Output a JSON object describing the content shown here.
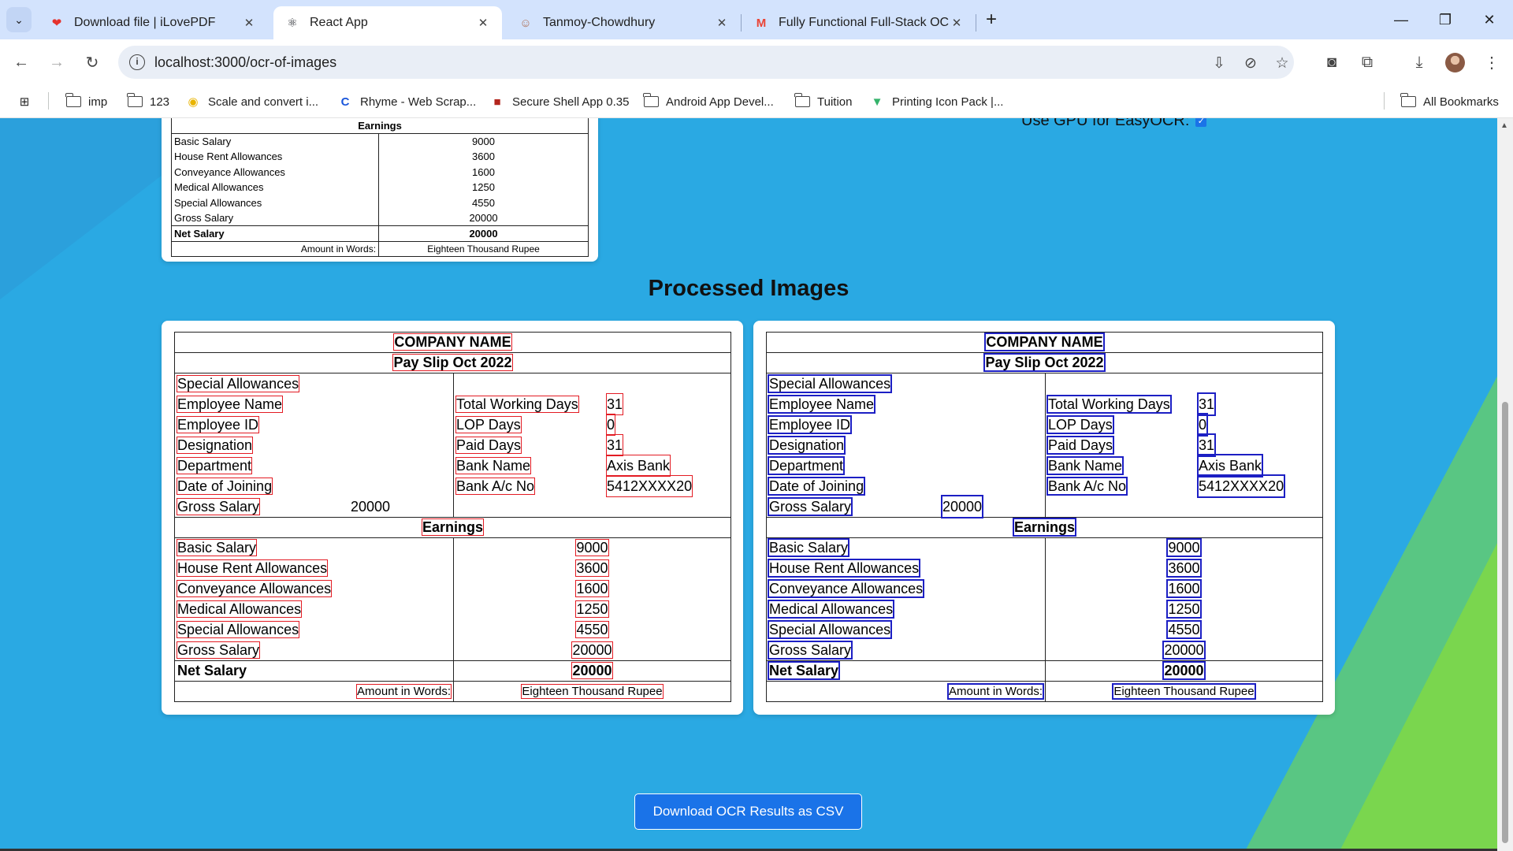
{
  "browser": {
    "tabs": [
      {
        "title": "Download file | iLovePDF",
        "icon": "heart-pdf-icon",
        "active": false
      },
      {
        "title": "React App",
        "icon": "react-icon",
        "active": true
      },
      {
        "title": "Tanmoy-Chowdhury",
        "icon": "person-icon",
        "active": false
      },
      {
        "title": "Fully Functional Full-Stack OCR",
        "icon": "gmail-icon",
        "active": false
      }
    ],
    "url": "localhost:3000/ocr-of-images",
    "bookmarks": [
      {
        "label": "imp",
        "icon": "folder-icon"
      },
      {
        "label": "123",
        "icon": "folder-icon"
      },
      {
        "label": "Scale and convert i...",
        "icon": "coin-icon"
      },
      {
        "label": "Rhyme - Web Scrap...",
        "icon": "rhyme-icon"
      },
      {
        "label": "Secure Shell App 0.35",
        "icon": "ssh-icon"
      },
      {
        "label": "Android App Devel...",
        "icon": "folder-icon"
      },
      {
        "label": "Tuition",
        "icon": "folder-icon"
      },
      {
        "label": "Printing Icon Pack |...",
        "icon": "v-icon"
      }
    ],
    "all_bookmarks": "All Bookmarks"
  },
  "page": {
    "gpu_label": "Use GPU for EasyOCR:",
    "gpu_checked": true,
    "processed_title": "Processed Images",
    "download_button": "Download OCR Results as CSV",
    "colors": {
      "background": "#2aa9e3",
      "button": "#1a73e8",
      "red_box": "#e31b23",
      "blue_box": "#1c1fc4"
    }
  },
  "partial_slip": {
    "earnings_header": "Earnings",
    "rows": [
      {
        "label": "Basic Salary",
        "value": "9000"
      },
      {
        "label": "House Rent Allowances",
        "value": "3600"
      },
      {
        "label": "Conveyance Allowances",
        "value": "1600"
      },
      {
        "label": "Medical Allowances",
        "value": "1250"
      },
      {
        "label": "Special Allowances",
        "value": "4550"
      },
      {
        "label": "Gross Salary",
        "value": "20000"
      }
    ],
    "net_label": "Net Salary",
    "net_value": "20000",
    "words_label": "Amount in Words:",
    "words_value": "Eighteen Thousand Rupee"
  },
  "slip": {
    "company": "COMPANY NAME",
    "payslip": "Pay Slip Oct 2022",
    "special": "Special Allowances",
    "left_fields": [
      "Employee Name",
      "Employee ID",
      "Designation",
      "Department",
      "Date of Joining"
    ],
    "right_fields": [
      {
        "label": "Total Working Days",
        "value": "31"
      },
      {
        "label": "LOP Days",
        "value": "0"
      },
      {
        "label": "Paid Days",
        "value": "31"
      },
      {
        "label": "Bank Name",
        "value": "Axis Bank"
      },
      {
        "label": "Bank A/c No",
        "value": "5412XXXX20"
      }
    ],
    "gross_label": "Gross Salary",
    "gross_value": "20000",
    "earnings_header": "Earnings",
    "earnings": [
      {
        "label": "Basic Salary",
        "value": "9000"
      },
      {
        "label": "House Rent Allowances",
        "value": "3600"
      },
      {
        "label": "Conveyance Allowances",
        "value": "1600"
      },
      {
        "label": "Medical Allowances",
        "value": "1250"
      },
      {
        "label": "Special Allowances",
        "value": "4550"
      },
      {
        "label": "Gross Salary",
        "value": "20000"
      }
    ],
    "net_label": "Net Salary",
    "net_value": "20000",
    "words_label": "Amount in Words:",
    "words_value": "Eighteen Thousand Rupee"
  }
}
